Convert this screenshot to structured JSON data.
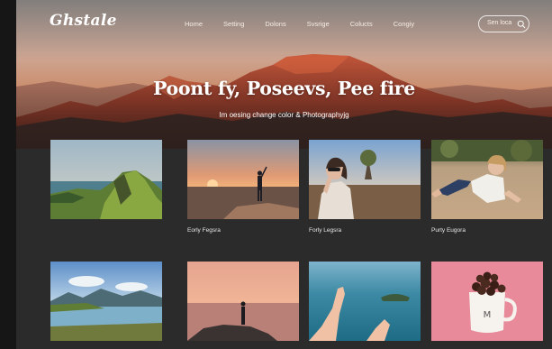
{
  "brand": {
    "logo": "Ghstale"
  },
  "nav": {
    "items": [
      "Home",
      "Setting",
      "Dolons",
      "Svsrige",
      "Colucts",
      "Congiy"
    ]
  },
  "search": {
    "placeholder": "Sen loca"
  },
  "hero": {
    "title": "Poont fy, Poseevs, Pee fire",
    "subtitle": "Im oesing change color & Photographyjg"
  },
  "gallery": {
    "row1": [
      {
        "scene": "coastal-cliff-landscape",
        "caption": ""
      },
      {
        "scene": "person-silhouette-sunset-rocks",
        "caption": "Eorly Fegsra"
      },
      {
        "scene": "woman-sunglasses-field-tree",
        "caption": "Forly Legsra"
      },
      {
        "scene": "girl-lying-on-ground",
        "caption": "Purty Eugora"
      }
    ],
    "row2": [
      {
        "scene": "lake-mountains",
        "caption": ""
      },
      {
        "scene": "person-standing-pink-sunset-sea",
        "caption": ""
      },
      {
        "scene": "hands-over-ocean-island",
        "caption": ""
      },
      {
        "scene": "mug-with-chocolates-pink",
        "caption": ""
      }
    ]
  },
  "colors": {
    "page_bg": "#2b2b2b",
    "outer_bg": "#161616",
    "text": "#ffffff"
  }
}
